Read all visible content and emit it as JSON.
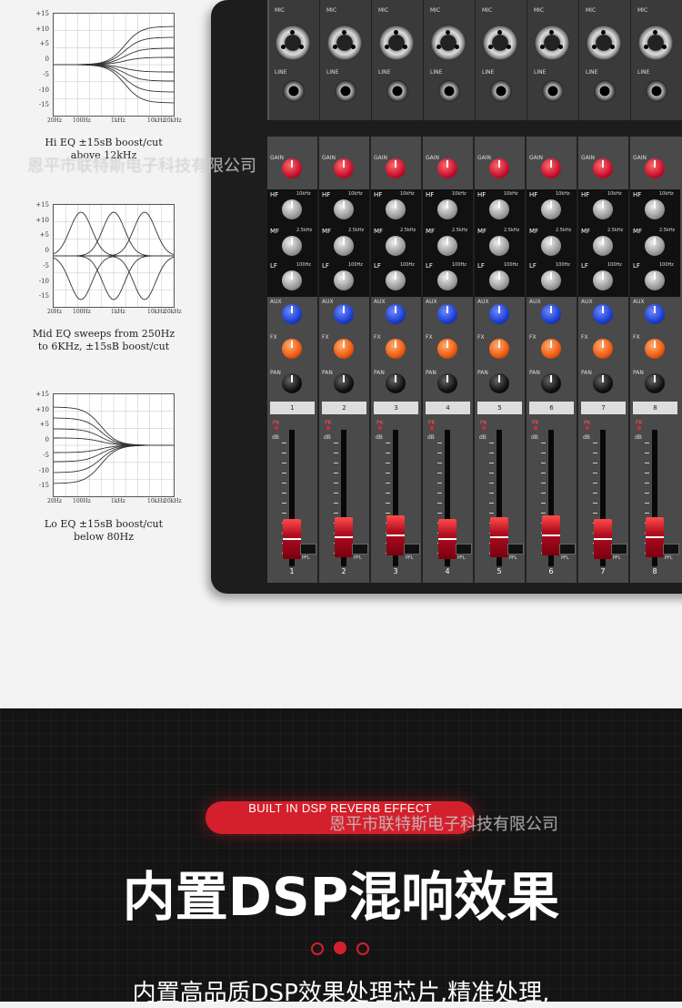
{
  "colors": {
    "accent_red": "#d4202c",
    "dark_bg": "#141414",
    "light_bg": "#f3f3f3"
  },
  "watermark": "恩平市联特斯电子科技有限公司",
  "eq_graphs": [
    {
      "y_ticks": [
        "+15",
        "+10",
        "+5",
        "0",
        "-5",
        "-10",
        "-15"
      ],
      "x_ticks": [
        "20Hz",
        "100Hz",
        "1kHz",
        "10kHz",
        "20kHz"
      ],
      "caption_line1": "Hi EQ ±15sB boost/cut",
      "caption_line2": "above 12kHz"
    },
    {
      "y_ticks": [
        "+15",
        "+10",
        "+5",
        "0",
        "-5",
        "-10",
        "-15"
      ],
      "x_ticks": [
        "20Hz",
        "100Hz",
        "1kHz",
        "10kHz",
        "20kHz"
      ],
      "caption_line1": "Mid EQ sweeps from 250Hz",
      "caption_line2": "to 6KHz, ±15sB boost/cut"
    },
    {
      "y_ticks": [
        "+15",
        "+10",
        "+5",
        "0",
        "-5",
        "-10",
        "-15"
      ],
      "x_ticks": [
        "20Hz",
        "100Hz",
        "1kHz",
        "10kHz",
        "20kHz"
      ],
      "caption_line1": "Lo EQ ±15sB boost/cut",
      "caption_line2": "below 80Hz"
    }
  ],
  "mixer": {
    "input_labels": {
      "mic": "MIC",
      "line": "LINE"
    },
    "control_labels": {
      "gain": "GAIN",
      "hf": "HF",
      "mf": "MF",
      "lf": "LF",
      "aux": "AUX",
      "fx": "FX",
      "pan": "PAN",
      "pk": "PK",
      "db": "dB",
      "pfl": "PFL"
    },
    "eq_freq_labels": {
      "hf": "10kHz",
      "mf": "2.5kHz",
      "lf": "100Hz"
    },
    "channels": [
      "1",
      "2",
      "3",
      "4",
      "5",
      "6",
      "7",
      "8"
    ]
  },
  "banner": {
    "pill_text": "BUILT IN DSP REVERB EFFECT",
    "heading": "内置DSP混响效果",
    "paragraph": "内置高品质DSP效果处理芯片,精准处理,"
  }
}
